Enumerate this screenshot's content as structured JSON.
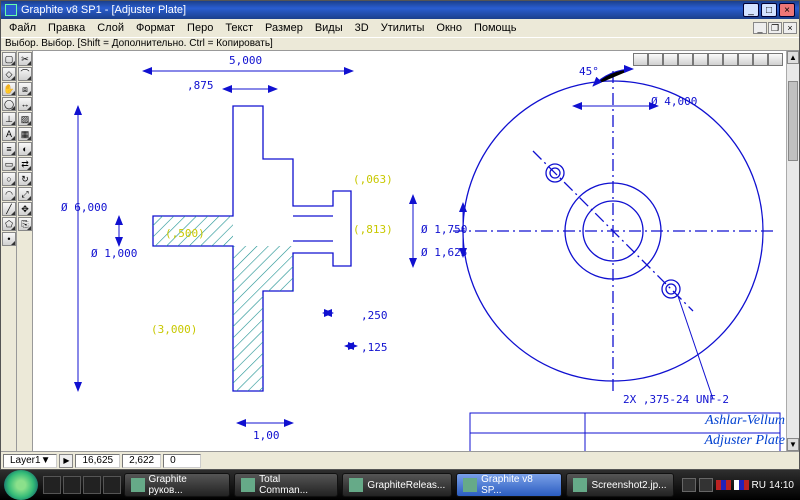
{
  "title": "Graphite v8 SP1 - [Adjuster Plate]",
  "menus": [
    "Файл",
    "Правка",
    "Слой",
    "Формат",
    "Перо",
    "Текст",
    "Размер",
    "Виды",
    "3D",
    "Утилиты",
    "Окно",
    "Помощь"
  ],
  "hint": "Выбор. Выбор. [Shift = Дополнительно. Ctrl = Копировать]",
  "tool_names": [
    "select",
    "lasso",
    "hand",
    "zoom",
    "ortho",
    "text",
    "layer",
    "rect",
    "circle",
    "arc",
    "line",
    "poly",
    "point",
    "trim",
    "fillet",
    "chamfer",
    "dim",
    "hatch",
    "view",
    "render",
    "mirror",
    "rotate",
    "scale",
    "move",
    "copy"
  ],
  "tool_glyphs": [
    "▢",
    "◇",
    "✋",
    "◯",
    "⊥",
    "A",
    "≡",
    "▭",
    "○",
    "◠",
    "╱",
    "⬠",
    "•",
    "✂",
    "⌒",
    "⧈",
    "↔",
    "▨",
    "▦",
    "◐",
    "⇄",
    "↻",
    "⤢",
    "✥",
    "⎘"
  ],
  "topright_icons": [
    "ico-a",
    "ico-b",
    "ico-c",
    "ico-d",
    "ico-e",
    "ico-f",
    "ico-g",
    "ico-h",
    "ico-i",
    "ico-j"
  ],
  "dimensions": {
    "d_6000": "Ø 6,000",
    "d_875": ",875",
    "d_1000": "Ø 1,000",
    "d_500": "(,500)",
    "d_063": "(,063)",
    "d_813": "(,813)",
    "d_1750": "Ø 1,750",
    "d_1625": "Ø 1,625",
    "d_250": ",250",
    "d_125": ",125",
    "d_100": "1,00",
    "d_3000": "(3,000)",
    "d_5000": "5,000",
    "d_45": "45°",
    "d_4000": "Ø 4,000",
    "d_note": "2X ,375-24 UNF-2"
  },
  "titleblock": {
    "company": "Ashlar-Vellum",
    "part": "Adjuster Plate"
  },
  "status": {
    "layer": "Layer1",
    "dropdown": "▼",
    "x": "16,625",
    "y": "2,622",
    "z": "0"
  },
  "taskbar": {
    "items": [
      "Graphite руков...",
      "Total Comman...",
      "GraphiteReleas...",
      "Graphite v8 SP...",
      "Screenshot2.jp..."
    ],
    "active_index": 3,
    "clock": "14:10",
    "lang": "RU"
  }
}
